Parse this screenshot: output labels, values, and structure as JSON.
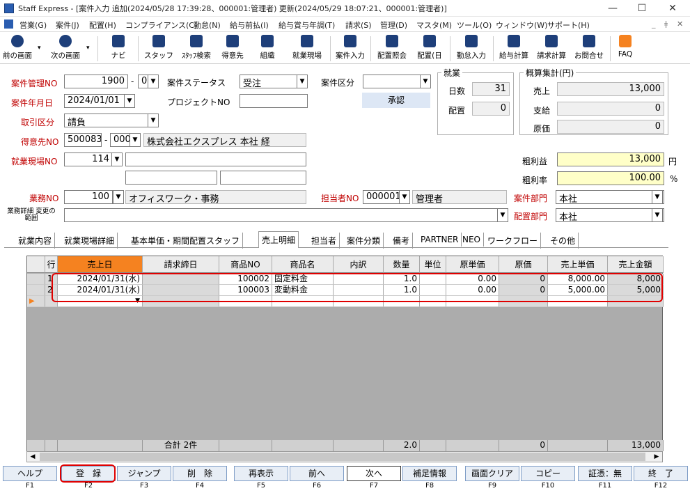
{
  "window": {
    "title": "Staff Express - [案件入力 追加(2024/05/28 17:39:28、000001:管理者) 更新(2024/05/29 18:07:21、000001:管理者)]",
    "min": "—",
    "max": "☐",
    "close": "✕",
    "child_min": "_",
    "child_restore": "ǂ",
    "child_close": "✕"
  },
  "menu": [
    "営業(G)",
    "案件(J)",
    "配置(H)",
    "コンプライアンス(C)",
    "勤怠(N)",
    "給与前払(I)",
    "給与賞与年調(T)",
    "請求(S)",
    "管理(D)",
    "マスタ(M)",
    "ツール(O)",
    "ウィンドウ(W)",
    "サポート(H)"
  ],
  "toolbar": {
    "prev": "前の画面",
    "next": "次の画面",
    "navi": "ナビ",
    "staff": "スタッフ",
    "staff_search": "ｽﾀｯﾌ検索",
    "customer": "得意先",
    "org": "組織",
    "site": "就業現場",
    "case_input": "案件入力",
    "assign_inquiry": "配置照会",
    "assign": "配置(日",
    "attendance": "勤怠入力",
    "payroll": "給与計算",
    "billing": "請求計算",
    "contact": "お問合せ",
    "faq": "FAQ"
  },
  "form": {
    "case_no_label": "案件管理NO",
    "case_no": "1900",
    "case_no_sep": "-",
    "case_no_sub": "000",
    "status_label": "案件ステータス",
    "status": "受注",
    "division_label": "案件区分",
    "approve": "承認",
    "date_label": "案件年月日",
    "date": "2024/01/01",
    "project_label": "プロジェクトNO",
    "deal_label": "取引区分",
    "deal": "請負",
    "customer_label": "得意先NO",
    "customer_no": "500083",
    "customer_sep": "-",
    "customer_sub": "000",
    "customer_name": "株式会社エクスプレス 本社 経",
    "site_label": "就業現場NO",
    "site_no": "114",
    "work_label": "業務NO",
    "work_no": "100",
    "work_name": "オフィスワーク・事務",
    "detail_label": "業務詳細 変更の範囲",
    "person_label": "担当者NO",
    "person_no": "000001",
    "person_name": "管理者",
    "dept_label": "案件部門",
    "dept": "本社",
    "assign_dept_label": "配置部門",
    "assign_dept": "本社"
  },
  "work_box": {
    "title": "就業",
    "days_label": "日数",
    "days": "31",
    "assign_label": "配置",
    "assign": "0"
  },
  "summary": {
    "title": "概算集計(円)",
    "sales_label": "売上",
    "sales": "13,000",
    "pay_label": "支給",
    "pay": "0",
    "cost_label": "原価",
    "cost": "0",
    "profit_label": "粗利益",
    "profit": "13,000",
    "profit_unit": "円",
    "rate_label": "粗利率",
    "rate": "100.00",
    "rate_unit": "%"
  },
  "tabs": [
    "就業内容",
    "就業現場詳細",
    "基本単価・期間配置スタッフ",
    "売上明細",
    "担当者",
    "案件分類",
    "備考",
    "PARTNER",
    "NEO",
    "ワークフロー",
    "その他"
  ],
  "grid": {
    "headers": [
      "行",
      "売上日",
      "請求締日",
      "商品NO",
      "商品名",
      "内訳",
      "数量",
      "単位",
      "原単価",
      "原価",
      "売上単価",
      "売上金額"
    ],
    "rows": [
      {
        "rowno": "1",
        "date": "2024/01/31(水)",
        "close": "",
        "prod_no": "100002",
        "prod_name": "固定料金",
        "detail": "",
        "qty": "1.0",
        "unit": "",
        "cost_unit": "0.00",
        "cost": "0",
        "sale_unit": "8,000.00",
        "amount": "8,000"
      },
      {
        "rowno": "2",
        "date": "2024/01/31(水)",
        "close": "",
        "prod_no": "100003",
        "prod_name": "変動料金",
        "detail": "",
        "qty": "1.0",
        "unit": "",
        "cost_unit": "0.00",
        "cost": "0",
        "sale_unit": "5,000.00",
        "amount": "5,000"
      }
    ],
    "footer": {
      "count": "合計 2件",
      "qty": "2.0",
      "cost": "0",
      "amount": "13,000"
    }
  },
  "fkeys": [
    {
      "label": "ヘルプ",
      "key": "F1"
    },
    {
      "label": "登　録",
      "key": "F2"
    },
    {
      "label": "ジャンプ",
      "key": "F3"
    },
    {
      "label": "削　除",
      "key": "F4"
    },
    {
      "label": "再表示",
      "key": "F5"
    },
    {
      "label": "前へ",
      "key": "F6"
    },
    {
      "label": "次へ",
      "key": "F7"
    },
    {
      "label": "補足情報",
      "key": "F8"
    },
    {
      "label": "画面クリア",
      "key": "F9"
    },
    {
      "label": "コピー",
      "key": "F10"
    },
    {
      "label": "証憑：無",
      "key": "F11"
    },
    {
      "label": "終　了",
      "key": "F12"
    }
  ],
  "colors": {
    "accent": "#f58220",
    "required_label": "#c00000",
    "highlight": "#e00000",
    "yellow_field": "#ffffc8"
  }
}
